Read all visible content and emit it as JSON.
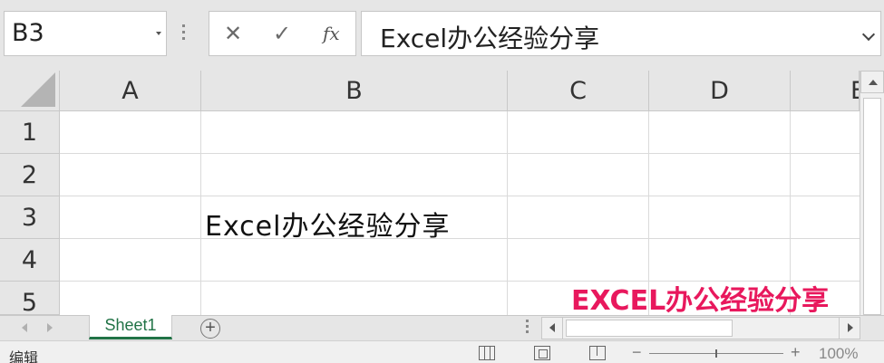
{
  "formula_bar": {
    "name_box": "B3",
    "cancel_icon": "✕",
    "enter_icon": "✓",
    "fx_label": "fx",
    "content": "Excel办公经验分享"
  },
  "grid": {
    "columns": [
      "A",
      "B",
      "C",
      "D",
      "E"
    ],
    "rows": [
      "1",
      "2",
      "3",
      "4",
      "5"
    ],
    "cells": {
      "B3": "Excel办公经验分享"
    }
  },
  "watermark": "EXCEL办公经验分享",
  "sheets": {
    "tabs": [
      "Sheet1"
    ],
    "active": "Sheet1",
    "add_label": "+"
  },
  "status_bar": {
    "mode": "编辑",
    "zoom_minus": "−",
    "zoom_plus": "+",
    "zoom": "100%"
  },
  "colors": {
    "accent": "#217346",
    "watermark": "#e8185d"
  }
}
